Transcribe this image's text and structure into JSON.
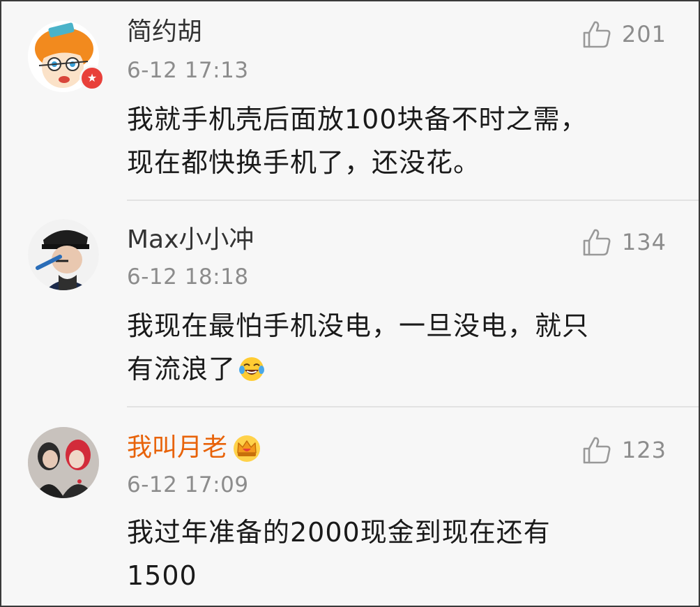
{
  "comments": [
    {
      "username": "简约胡",
      "time": "6-12 17:13",
      "likes": "201",
      "text_lines": [
        "我就手机壳后面放100块备不时之需，",
        "现在都快换手机了，还没花。"
      ],
      "avatar_icon": "cartoon-face-avatar",
      "badge": "vip-badge"
    },
    {
      "username": "Max小小冲",
      "time": "6-12 18:18",
      "likes": "134",
      "text_lines": [
        "我现在最怕手机没电，一旦没电，就只",
        "有流浪了"
      ],
      "avatar_icon": "man-with-cap-avatar",
      "emoji": "laughing-tears-emoji"
    },
    {
      "username": "我叫月老",
      "time": "6-12 17:09",
      "likes": "123",
      "text_lines": [
        "我过年准备的2000现金到现在还有",
        "1500"
      ],
      "avatar_icon": "two-people-avatar",
      "badge": "crown-icon",
      "username_color": "#e8630a"
    }
  ],
  "colors": {
    "background": "#f7f7f7",
    "username": "#333333",
    "vip_username": "#e8630a",
    "meta": "#8c8c8c",
    "divider": "#e2e2e2"
  }
}
